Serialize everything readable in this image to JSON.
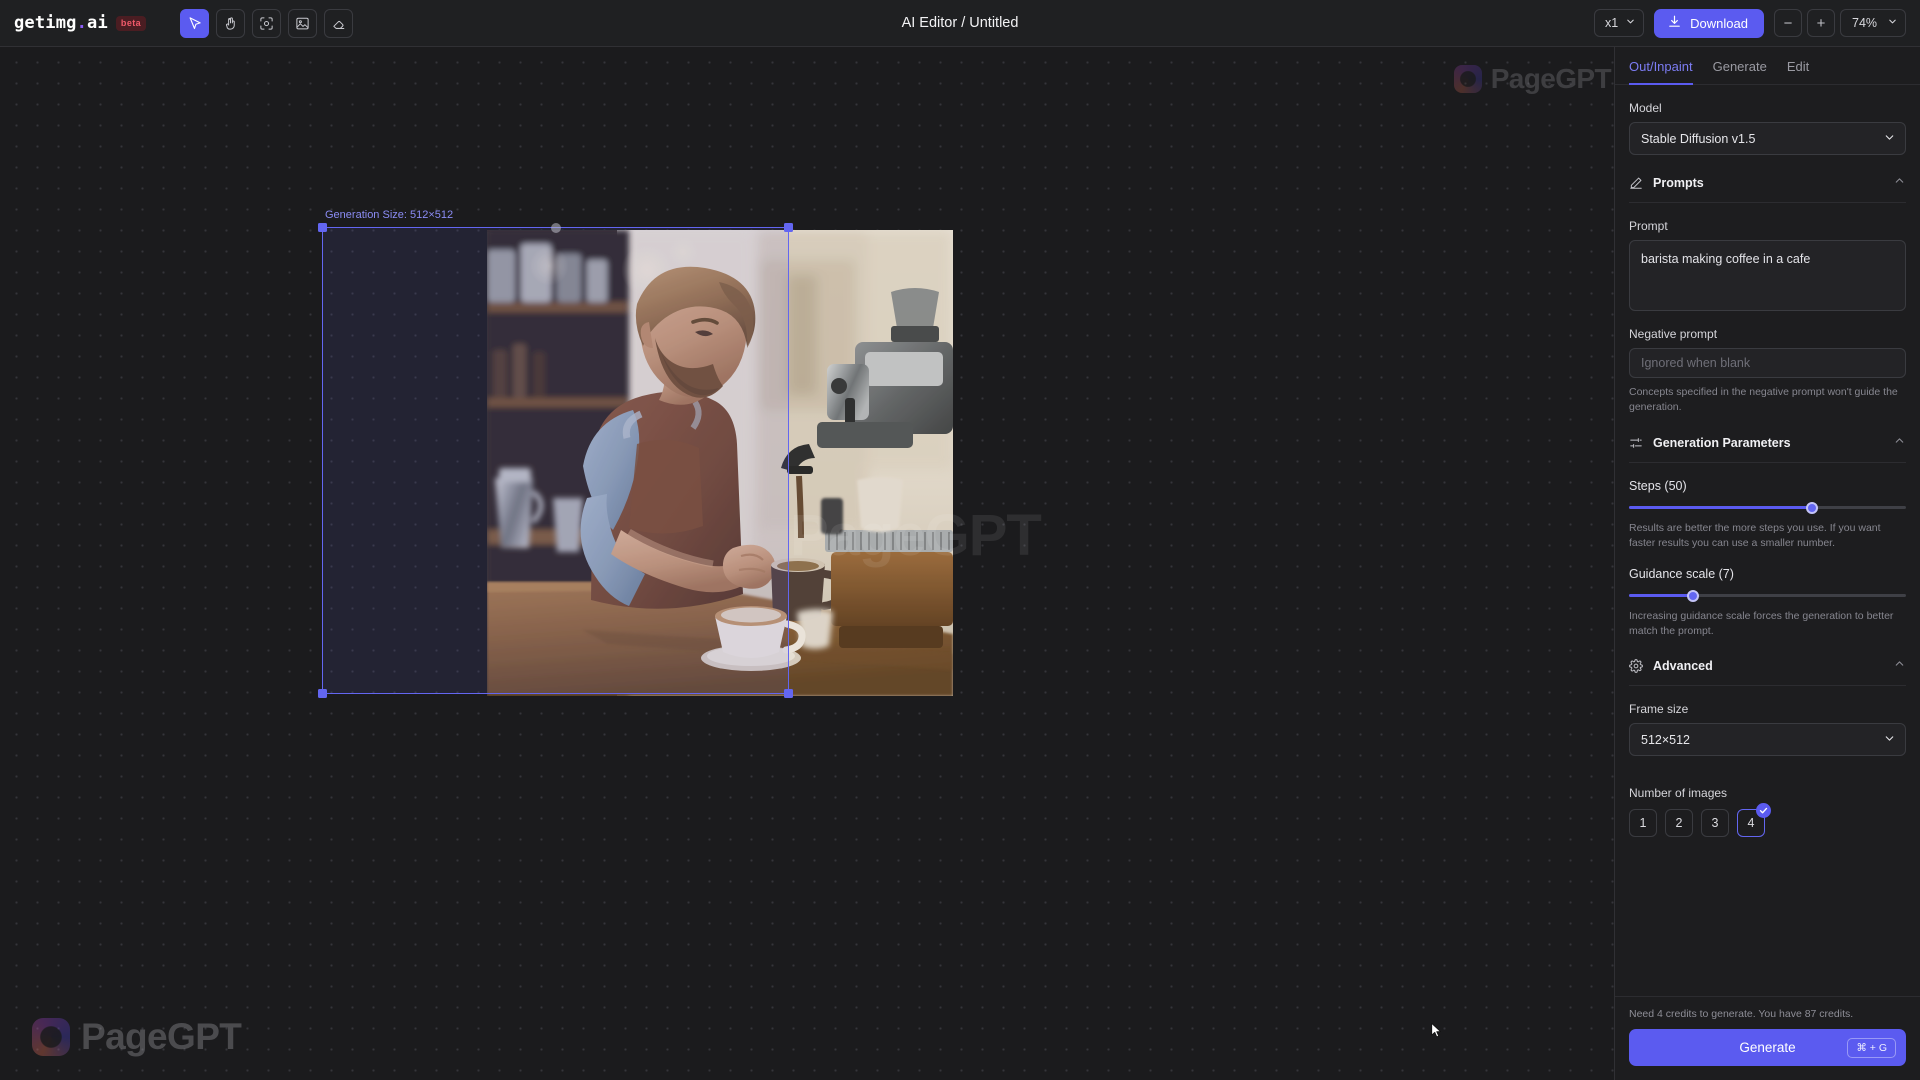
{
  "topbar": {
    "brand_name": "getimg",
    "brand_dot": ".",
    "brand_tld": "ai",
    "beta_label": "beta",
    "doc_title": "AI Editor / Untitled",
    "tools": [
      {
        "name": "select-tool",
        "icon": "cursor-arrow-icon",
        "active": true
      },
      {
        "name": "pan-tool",
        "icon": "hand-icon",
        "active": false
      },
      {
        "name": "frame-tool",
        "icon": "focus-frame-icon",
        "active": false
      },
      {
        "name": "image-tool",
        "icon": "image-icon",
        "active": false
      },
      {
        "name": "eraser-tool",
        "icon": "eraser-icon",
        "active": false
      }
    ],
    "scale_value": "x1",
    "download_label": "Download",
    "zoom_out_label": "−",
    "zoom_in_label": "+",
    "zoom_level": "74%"
  },
  "canvas": {
    "selection_label": "Generation Size: 512×512",
    "watermark": "PageGPT"
  },
  "panel": {
    "tabs": [
      {
        "label": "Out/Inpaint",
        "active": true
      },
      {
        "label": "Generate",
        "active": false
      },
      {
        "label": "Edit",
        "active": false
      }
    ],
    "model": {
      "label": "Model",
      "value": "Stable Diffusion v1.5"
    },
    "prompts": {
      "section_title": "Prompts",
      "prompt_label": "Prompt",
      "prompt_value": "barista making coffee in a cafe",
      "negative_label": "Negative prompt",
      "negative_placeholder": "Ignored when blank",
      "negative_helper": "Concepts specified in the negative prompt won't guide the generation."
    },
    "generation_parameters": {
      "section_title": "Generation Parameters",
      "steps_label": "Steps (50)",
      "steps_value": 50,
      "steps_percent": 66,
      "steps_helper": "Results are better the more steps you use. If you want faster results you can use a smaller number.",
      "guidance_label": "Guidance scale (7)",
      "guidance_value": 7,
      "guidance_percent": 23,
      "guidance_helper": "Increasing guidance scale forces the generation to better match the prompt."
    },
    "advanced": {
      "section_title": "Advanced",
      "frame_size_label": "Frame size",
      "frame_size_value": "512×512",
      "number_of_images_label": "Number of images",
      "number_options": [
        "1",
        "2",
        "3",
        "4"
      ],
      "number_selected": "4"
    },
    "footer": {
      "credits_text": "Need 4 credits to generate. You have 87 credits.",
      "generate_label": "Generate",
      "shortcut": "⌘ + G"
    }
  },
  "colors": {
    "accent": "#5b5bf0",
    "accent_light": "#6366f1",
    "panel_bg": "#1d1d1f",
    "canvas_bg": "#1b1b1d",
    "topbar_bg": "#1f2022",
    "beta_bg": "#4a1d22",
    "beta_fg": "#f05a6a"
  }
}
